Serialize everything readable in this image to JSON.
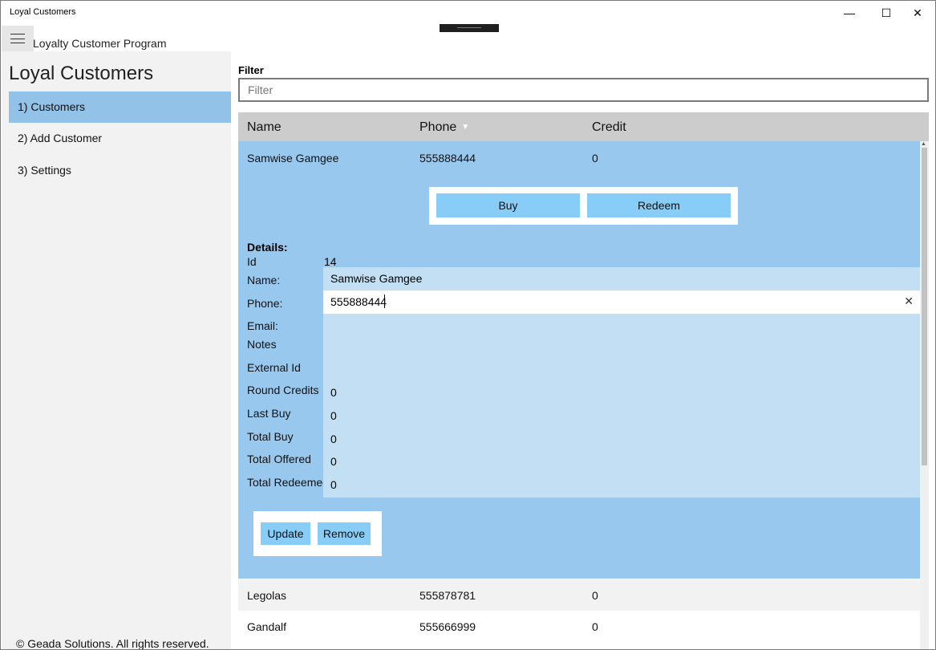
{
  "window": {
    "title": "Loyal Customers",
    "min_glyph": "—",
    "max_glyph": "☐",
    "close_glyph": "✕"
  },
  "header": {
    "app_title": "Loyalty Customer Program"
  },
  "sidebar": {
    "title": "Loyal Customers",
    "items": [
      {
        "label": "1) Customers",
        "selected": true
      },
      {
        "label": "2) Add Customer",
        "selected": false
      },
      {
        "label": "3) Settings",
        "selected": false
      }
    ],
    "footer": "© Geada Solutions. All rights reserved."
  },
  "filter": {
    "label": "Filter",
    "placeholder": "Filter",
    "value": ""
  },
  "grid": {
    "columns": [
      "Name",
      "Phone",
      "Credit"
    ],
    "sort_glyph": "▼",
    "rows": [
      {
        "name": "Samwise Gamgee",
        "phone": "555888444",
        "credit": "0",
        "expanded": true
      },
      {
        "name": "Legolas",
        "phone": "555878781",
        "credit": "0"
      },
      {
        "name": "Gandalf",
        "phone": "555666999",
        "credit": "0"
      }
    ]
  },
  "actions": {
    "buy": "Buy",
    "redeem": "Redeem",
    "update": "Update",
    "remove": "Remove"
  },
  "details": {
    "heading": "Details:",
    "labels": {
      "id": "Id",
      "name": "Name:",
      "phone": "Phone:",
      "email": "Email:",
      "notes": "Notes",
      "external_id": "External Id",
      "round_credits": "Round Credits",
      "last_buy": "Last Buy",
      "total_buy": "Total Buy",
      "total_offered": "Total Offered",
      "total_redeemed": "Total Redeemed"
    },
    "values": {
      "id": "14",
      "name": "Samwise Gamgee",
      "phone": "555888444",
      "round_credits": "0",
      "last_buy": "0",
      "total_buy": "0",
      "total_offered": "0",
      "total_redeemed": "0"
    },
    "clear_glyph": "✕"
  },
  "colors": {
    "selected": "#93c2e9",
    "expanded_row": "#99c8ef",
    "button": "#87cdf8",
    "detail_panel": "#c3dff4"
  }
}
